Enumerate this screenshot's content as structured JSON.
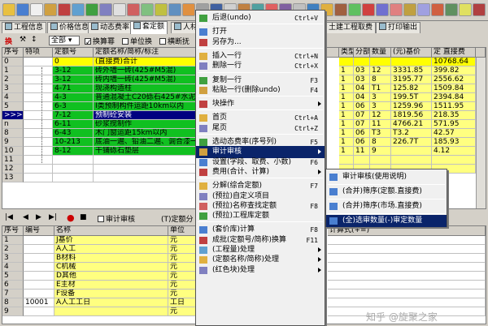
{
  "tabs": [
    {
      "label": "工程信息"
    },
    {
      "label": "价格信息"
    },
    {
      "label": "动态费率"
    },
    {
      "label": "套定额"
    },
    {
      "label": "人材机"
    }
  ],
  "right_tabs": [
    {
      "label": "土建工程取费"
    },
    {
      "label": "打印输出"
    }
  ],
  "filter": {
    "first_btn": "换",
    "select_value": "全部",
    "chk1": "换算幂",
    "chk2": "单位换",
    "chk3": "横断抚"
  },
  "top_grid": {
    "headers": [
      "序号",
      "特项",
      "定额号",
      "定额名称/简称/标注"
    ],
    "rows": [
      {
        "n": "0",
        "code": "0",
        "name": "(直接费)合计",
        "hl": "yellow"
      },
      {
        "n": "1",
        "code": "3-12",
        "name": "砖外墙一砖(425#M5混)",
        "hl": "green"
      },
      {
        "n": "2",
        "code": "3-12",
        "name": "砖内墙一砖(425#M5混)",
        "hl": "green"
      },
      {
        "n": "3",
        "code": "4-71",
        "name": "现浇构造柱",
        "hl": "green"
      },
      {
        "n": "4",
        "code": "4-3",
        "name": "普通混凝土C20砾石425#水泥",
        "hl": "green"
      },
      {
        "n": "5",
        "code": "6-3",
        "name": "I类预制构件运距10km以内",
        "hl": "green"
      },
      {
        "n": ">>>>",
        "code": "7-12",
        "name": "预制砼安装",
        "hl": "green-sel"
      },
      {
        "n": "n",
        "code": "6-11",
        "name": "砂浆搅制作",
        "hl": "green"
      },
      {
        "n": "8",
        "code": "6-43",
        "name": "木门窗运距15km以内",
        "hl": "green"
      },
      {
        "n": "9",
        "code": "10-213",
        "name": "底油一遍、铅油二遍、调合漆一",
        "hl": "green"
      },
      {
        "n": "10",
        "code": "8-12",
        "name": "干铺砾石垫层",
        "hl": "green"
      },
      {
        "n": "11",
        "code": "",
        "name": "",
        "hl": ""
      },
      {
        "n": "12",
        "code": "",
        "name": "",
        "hl": ""
      },
      {
        "n": "13",
        "code": "",
        "name": "",
        "hl": ""
      }
    ]
  },
  "right_grid": {
    "headers": [
      "类型",
      "分部",
      "数量",
      "(元)基价",
      "定 直接费"
    ],
    "rows": [
      {
        "t": "",
        "f": "",
        "q": "",
        "p": "",
        "d": "10768.64"
      },
      {
        "t": "1",
        "f": "03",
        "q": "12",
        "p": "3331.85",
        "d": "399.82"
      },
      {
        "t": "1",
        "f": "03",
        "q": "8",
        "p": "3195.77",
        "d": "2556.62"
      },
      {
        "t": "1",
        "f": "04",
        "q": "T1",
        "p": "125.82",
        "d": "1509.84"
      },
      {
        "t": "1",
        "f": "04",
        "q": "3",
        "p": "199.5T",
        "d": "2394.84"
      },
      {
        "t": "1",
        "f": "06",
        "q": "3",
        "p": "1259.96",
        "d": "1511.95"
      },
      {
        "t": "1",
        "f": "07",
        "q": "12",
        "p": "1819.56",
        "d": "218.35"
      },
      {
        "t": "1",
        "f": "07",
        "q": "11",
        "p": "4766.21",
        "d": "571.95"
      },
      {
        "t": "1",
        "f": "06",
        "q": "T3",
        "p": "T3.2",
        "d": "42.57"
      },
      {
        "t": "1",
        "f": "06",
        "q": "8",
        "p": "226.7T",
        "d": "185.93"
      },
      {
        "t": "1",
        "f": "11",
        "q": "9",
        "p": "",
        "d": "4.12"
      },
      {
        "t": "",
        "f": "",
        "q": "",
        "p": "",
        "d": ""
      },
      {
        "t": "",
        "f": "",
        "q": "",
        "p": "",
        "d": ""
      }
    ]
  },
  "bottom_toolbar": {
    "chk_label": "审计审核",
    "extra": "(T)定额分"
  },
  "bottom_grid": {
    "headers": [
      "序号",
      "编号",
      "名称",
      "单位"
    ],
    "rows": [
      {
        "n": "1",
        "code": "",
        "name": "J基价",
        "unit": "元"
      },
      {
        "n": "2",
        "code": "",
        "name": "A人工",
        "unit": "元"
      },
      {
        "n": "3",
        "code": "",
        "name": "B材料",
        "unit": "元"
      },
      {
        "n": "4",
        "code": "",
        "name": "C机械",
        "unit": "元"
      },
      {
        "n": "5",
        "code": "",
        "name": "D其他",
        "unit": "元"
      },
      {
        "n": "6",
        "code": "",
        "name": "E主材",
        "unit": "元"
      },
      {
        "n": "7",
        "code": "",
        "name": "F设备",
        "unit": "元"
      },
      {
        "n": "8",
        "code": "10001",
        "name": "A人工工日",
        "unit": "工日"
      },
      {
        "n": "9",
        "code": "",
        "name": "",
        "unit": "元"
      }
    ],
    "right_header": "计算式(+=)"
  },
  "context_menu": {
    "items": [
      {
        "label": "后退(undo)",
        "sc": "Ctrl+V"
      },
      {
        "sep": true
      },
      {
        "label": "打开",
        "sc": ""
      },
      {
        "label": "另存为...",
        "sc": ""
      },
      {
        "sep": true
      },
      {
        "label": "插入一行",
        "sc": "Ctrl+N"
      },
      {
        "label": "删除一行",
        "sc": "Ctrl+X"
      },
      {
        "sep": true
      },
      {
        "label": "复制一行",
        "sc": "F3"
      },
      {
        "label": "粘贴一行(删除undo)",
        "sc": "F4"
      },
      {
        "sep": true
      },
      {
        "label": "块操作",
        "sc": "",
        "arrow": true
      },
      {
        "sep": true
      },
      {
        "label": "首页",
        "sc": "Ctrl+A"
      },
      {
        "label": "尾页",
        "sc": "Ctrl+Z"
      },
      {
        "sep": true
      },
      {
        "label": "选动态费率(序号列)",
        "sc": "F5"
      },
      {
        "label": "审计审核",
        "sc": "",
        "arrow": true,
        "hl": true
      },
      {
        "label": "设置(字段、取费、小数)",
        "sc": "F6"
      },
      {
        "label": "费用(合计、计算)",
        "sc": "",
        "arrow": true
      },
      {
        "sep": true
      },
      {
        "label": "分解(综合定额)",
        "sc": "F7"
      },
      {
        "label": "(预拉)自定义项目",
        "sc": ""
      },
      {
        "label": "(预拉)名称查找定额",
        "sc": "F8"
      },
      {
        "label": "(预拉)工程库定额",
        "sc": ""
      },
      {
        "sep": true
      },
      {
        "label": "(套价库)计算",
        "sc": "F8"
      },
      {
        "label": "成批(定额号/简称)换算",
        "sc": "F11"
      },
      {
        "label": "(工程量)处理",
        "sc": "",
        "arrow": true
      },
      {
        "label": "(定额名称/简称)处理",
        "sc": "",
        "arrow": true
      },
      {
        "label": "(红色块)处理",
        "sc": "",
        "arrow": true
      }
    ]
  },
  "sub_menu": {
    "items": [
      {
        "label": "审计审核(使用说明)"
      },
      {
        "sep": true
      },
      {
        "label": "(合并)筛序(定额.直接费)"
      },
      {
        "sep": true
      },
      {
        "label": "(合并)筛序(市场.直接费)"
      },
      {
        "sep": true
      },
      {
        "label": "(全)选审数量(-)审定数量",
        "hl": true
      }
    ]
  },
  "watermark": "知乎 @旋聚之家"
}
